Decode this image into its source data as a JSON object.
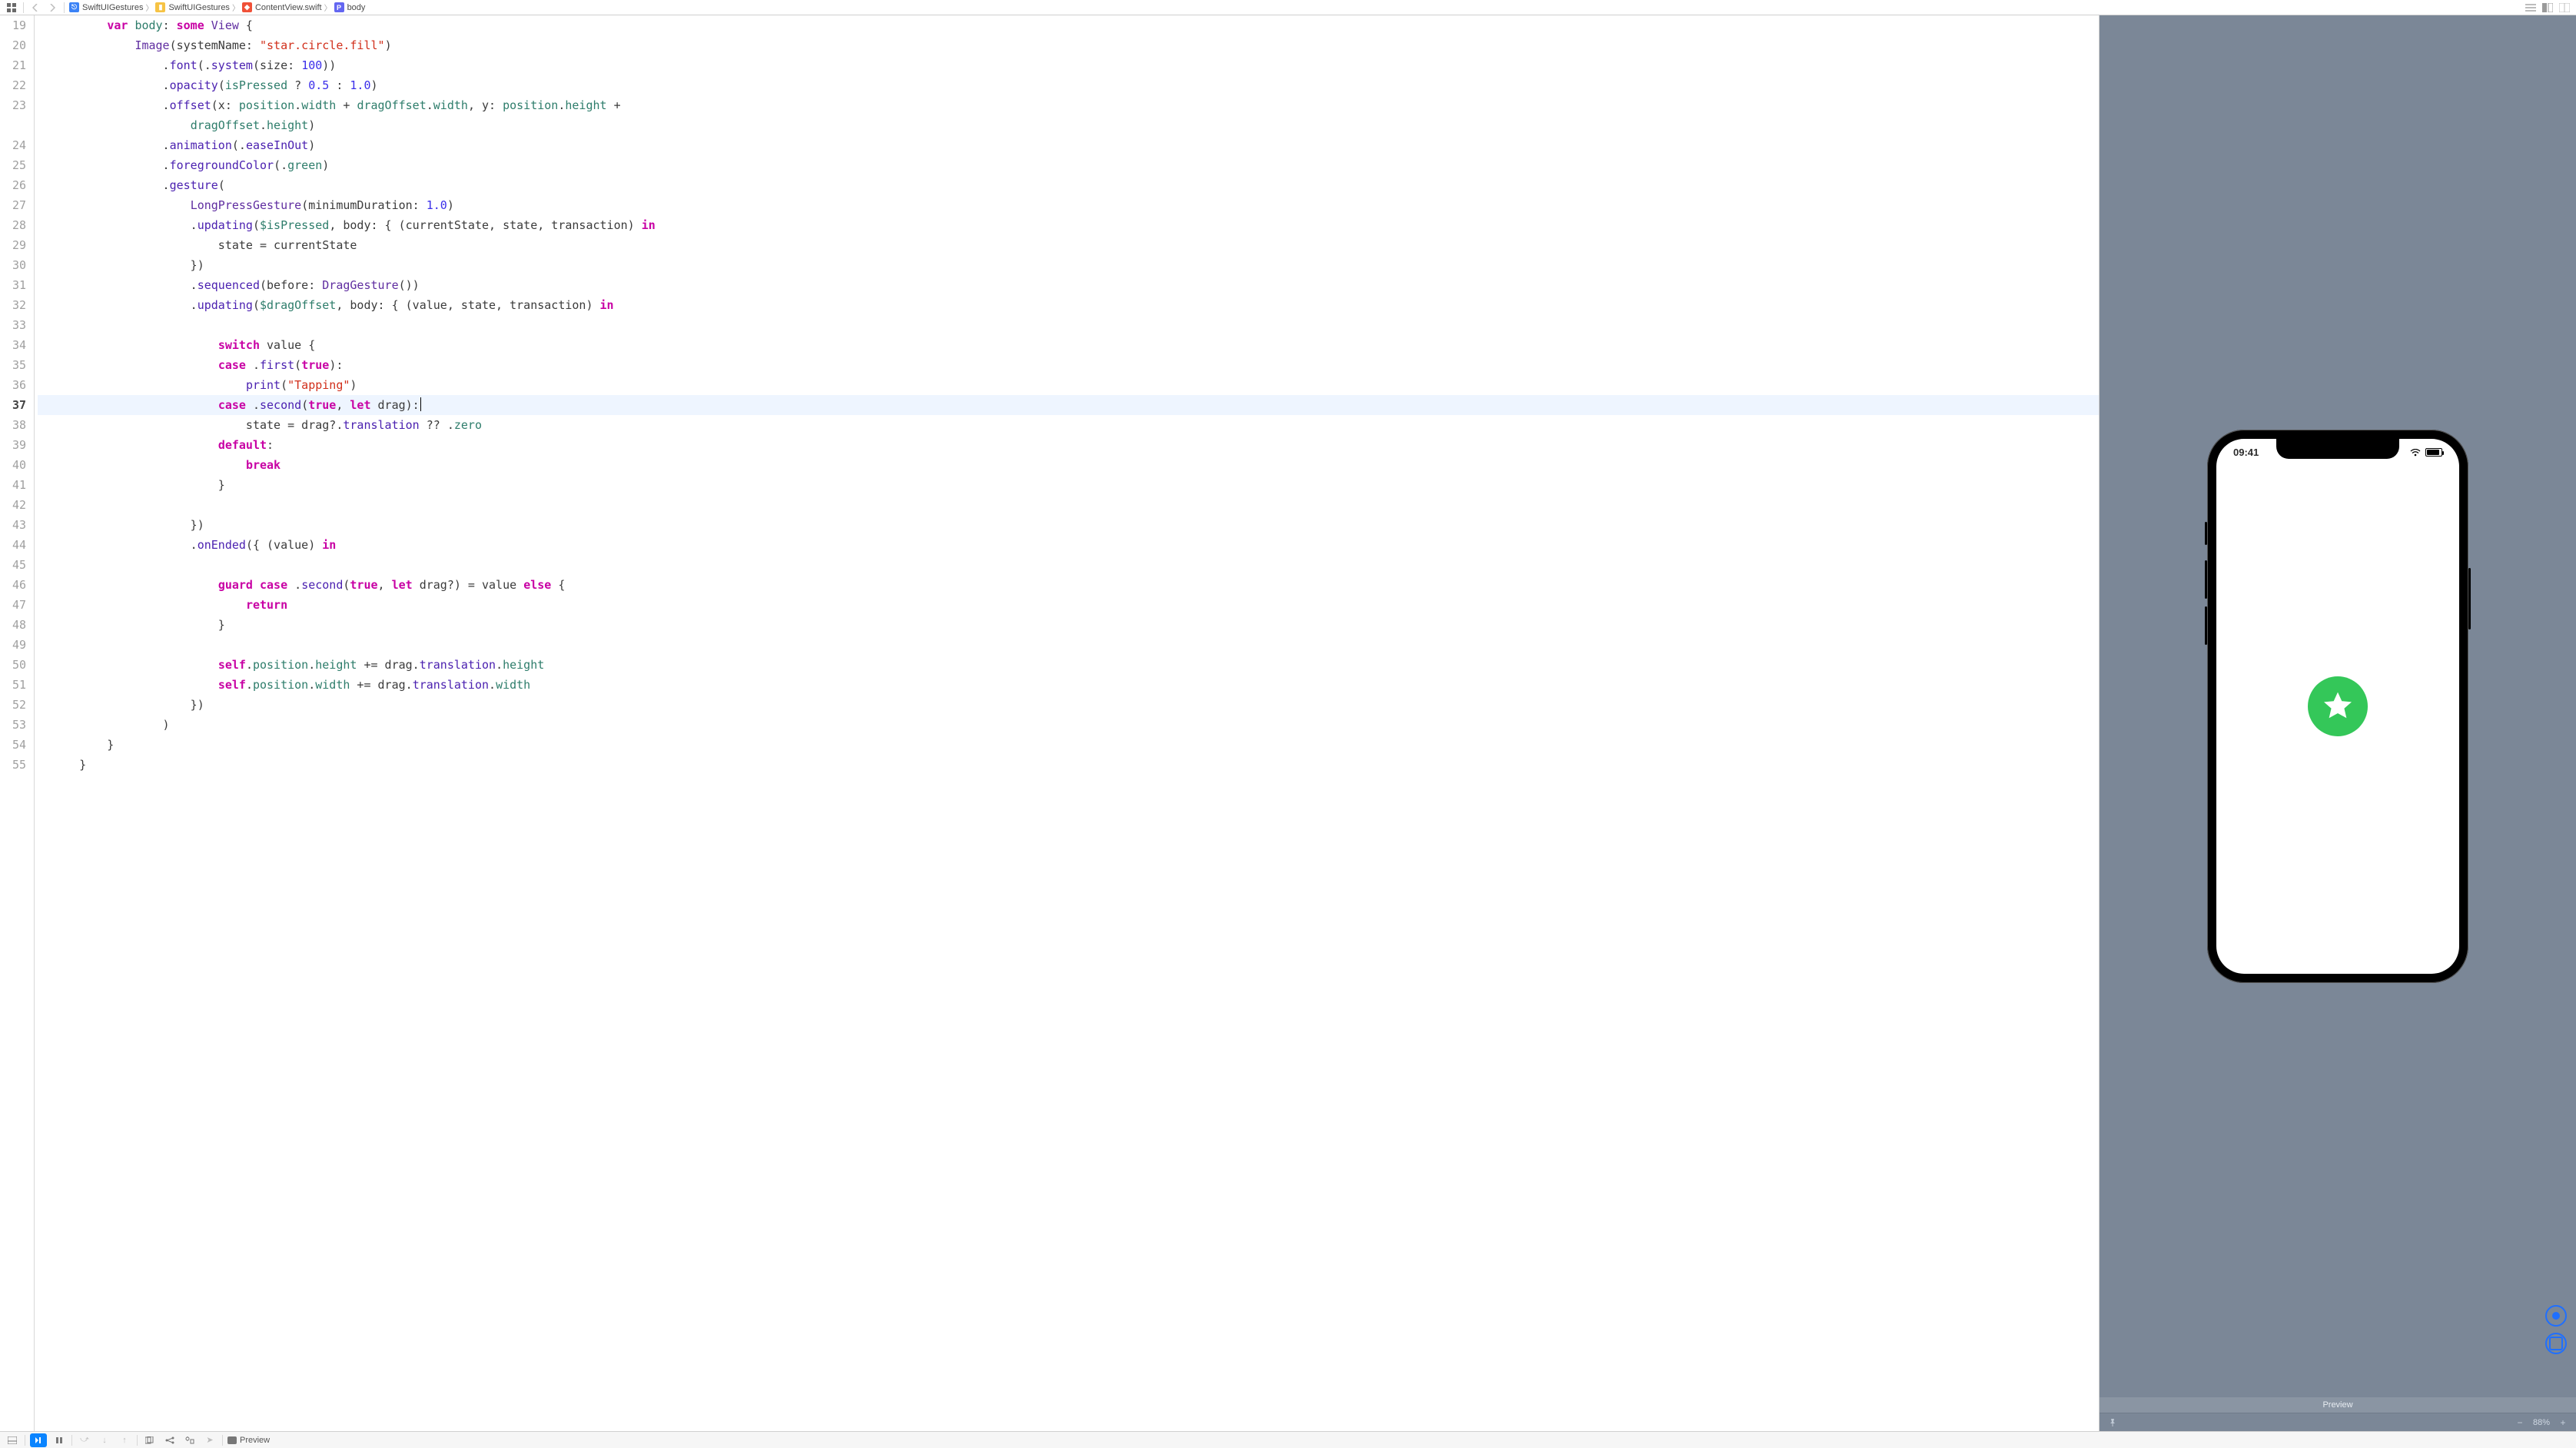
{
  "breadcrumb": {
    "items": [
      {
        "icon": "proj",
        "label": "SwiftUIGestures"
      },
      {
        "icon": "folder",
        "label": "SwiftUIGestures"
      },
      {
        "icon": "swift",
        "label": "ContentView.swift"
      },
      {
        "icon": "prop",
        "label": "body"
      }
    ]
  },
  "editor": {
    "first_line_number": 19,
    "highlighted_line": 37
  },
  "code_lines": [
    {
      "n": 19,
      "tokens": [
        [
          "pl",
          "          "
        ],
        [
          "k",
          "var"
        ],
        [
          "pl",
          " "
        ],
        [
          "id",
          "body"
        ],
        [
          "pl",
          ": "
        ],
        [
          "k",
          "some"
        ],
        [
          "pl",
          " "
        ],
        [
          "ty",
          "View"
        ],
        [
          "pl",
          " {"
        ]
      ]
    },
    {
      "n": 20,
      "tokens": [
        [
          "pl",
          "              "
        ],
        [
          "ty",
          "Image"
        ],
        [
          "pl",
          "(systemName: "
        ],
        [
          "str",
          "\"star.circle.fill\""
        ],
        [
          "pl",
          ")"
        ]
      ]
    },
    {
      "n": 21,
      "tokens": [
        [
          "pl",
          "                  ."
        ],
        [
          "fn",
          "font"
        ],
        [
          "pl",
          "(."
        ],
        [
          "fn",
          "system"
        ],
        [
          "pl",
          "(size: "
        ],
        [
          "lit",
          "100"
        ],
        [
          "pl",
          "))"
        ]
      ]
    },
    {
      "n": 22,
      "tokens": [
        [
          "pl",
          "                  ."
        ],
        [
          "fn",
          "opacity"
        ],
        [
          "pl",
          "("
        ],
        [
          "id",
          "isPressed"
        ],
        [
          "pl",
          " ? "
        ],
        [
          "lit",
          "0.5"
        ],
        [
          "pl",
          " : "
        ],
        [
          "lit",
          "1.0"
        ],
        [
          "pl",
          ")"
        ]
      ]
    },
    {
      "n": 23,
      "tokens": [
        [
          "pl",
          "                  ."
        ],
        [
          "fn",
          "offset"
        ],
        [
          "pl",
          "(x: "
        ],
        [
          "id",
          "position"
        ],
        [
          "pl",
          "."
        ],
        [
          "id",
          "width"
        ],
        [
          "pl",
          " + "
        ],
        [
          "id",
          "dragOffset"
        ],
        [
          "pl",
          "."
        ],
        [
          "id",
          "width"
        ],
        [
          "pl",
          ", y: "
        ],
        [
          "id",
          "position"
        ],
        [
          "pl",
          "."
        ],
        [
          "id",
          "height"
        ],
        [
          "pl",
          " +"
        ]
      ]
    },
    {
      "n": 20.5,
      "cont": true,
      "tokens": [
        [
          "pl",
          "                      "
        ],
        [
          "id",
          "dragOffset"
        ],
        [
          "pl",
          "."
        ],
        [
          "id",
          "height"
        ],
        [
          "pl",
          ")"
        ]
      ]
    },
    {
      "n": 24,
      "tokens": [
        [
          "pl",
          "                  ."
        ],
        [
          "fn",
          "animation"
        ],
        [
          "pl",
          "(."
        ],
        [
          "fn",
          "easeInOut"
        ],
        [
          "pl",
          ")"
        ]
      ]
    },
    {
      "n": 25,
      "tokens": [
        [
          "pl",
          "                  ."
        ],
        [
          "fn",
          "foregroundColor"
        ],
        [
          "pl",
          "(."
        ],
        [
          "id",
          "green"
        ],
        [
          "pl",
          ")"
        ]
      ]
    },
    {
      "n": 26,
      "tokens": [
        [
          "pl",
          "                  ."
        ],
        [
          "fn",
          "gesture"
        ],
        [
          "pl",
          "("
        ]
      ]
    },
    {
      "n": 27,
      "tokens": [
        [
          "pl",
          "                      "
        ],
        [
          "ty",
          "LongPressGesture"
        ],
        [
          "pl",
          "(minimumDuration: "
        ],
        [
          "lit",
          "1.0"
        ],
        [
          "pl",
          ")"
        ]
      ]
    },
    {
      "n": 28,
      "tokens": [
        [
          "pl",
          "                      ."
        ],
        [
          "fn",
          "updating"
        ],
        [
          "pl",
          "("
        ],
        [
          "id",
          "$isPressed"
        ],
        [
          "pl",
          ", body: { (currentState, state, transaction) "
        ],
        [
          "k",
          "in"
        ]
      ]
    },
    {
      "n": 29,
      "tokens": [
        [
          "pl",
          "                          state = currentState"
        ]
      ]
    },
    {
      "n": 30,
      "tokens": [
        [
          "pl",
          "                      })"
        ]
      ]
    },
    {
      "n": 31,
      "tokens": [
        [
          "pl",
          "                      ."
        ],
        [
          "fn",
          "sequenced"
        ],
        [
          "pl",
          "(before: "
        ],
        [
          "ty",
          "DragGesture"
        ],
        [
          "pl",
          "())"
        ]
      ]
    },
    {
      "n": 32,
      "tokens": [
        [
          "pl",
          "                      ."
        ],
        [
          "fn",
          "updating"
        ],
        [
          "pl",
          "("
        ],
        [
          "id",
          "$dragOffset"
        ],
        [
          "pl",
          ", body: { (value, state, transaction) "
        ],
        [
          "k",
          "in"
        ]
      ]
    },
    {
      "n": 33,
      "tokens": [
        [
          "pl",
          "                          "
        ]
      ]
    },
    {
      "n": 34,
      "tokens": [
        [
          "pl",
          "                          "
        ],
        [
          "k",
          "switch"
        ],
        [
          "pl",
          " value {"
        ]
      ]
    },
    {
      "n": 35,
      "tokens": [
        [
          "pl",
          "                          "
        ],
        [
          "k",
          "case"
        ],
        [
          "pl",
          " ."
        ],
        [
          "fn",
          "first"
        ],
        [
          "pl",
          "("
        ],
        [
          "k",
          "true"
        ],
        [
          "pl",
          "):"
        ]
      ]
    },
    {
      "n": 36,
      "tokens": [
        [
          "pl",
          "                              "
        ],
        [
          "fn",
          "print"
        ],
        [
          "pl",
          "("
        ],
        [
          "str",
          "\"Tapping\""
        ],
        [
          "pl",
          ")"
        ]
      ]
    },
    {
      "n": 37,
      "hl": true,
      "tokens": [
        [
          "pl",
          "                          "
        ],
        [
          "k",
          "case"
        ],
        [
          "pl",
          " ."
        ],
        [
          "fn",
          "second"
        ],
        [
          "pl",
          "("
        ],
        [
          "k",
          "true"
        ],
        [
          "pl",
          ", "
        ],
        [
          "k",
          "let"
        ],
        [
          "pl",
          " drag):"
        ],
        [
          "cursor",
          ""
        ]
      ]
    },
    {
      "n": 38,
      "tokens": [
        [
          "pl",
          "                              state = drag?."
        ],
        [
          "fn",
          "translation"
        ],
        [
          "pl",
          " ?? ."
        ],
        [
          "id",
          "zero"
        ]
      ]
    },
    {
      "n": 39,
      "tokens": [
        [
          "pl",
          "                          "
        ],
        [
          "k",
          "default"
        ],
        [
          "pl",
          ":"
        ]
      ]
    },
    {
      "n": 40,
      "tokens": [
        [
          "pl",
          "                              "
        ],
        [
          "k",
          "break"
        ]
      ]
    },
    {
      "n": 41,
      "tokens": [
        [
          "pl",
          "                          }"
        ]
      ]
    },
    {
      "n": 42,
      "tokens": [
        [
          "pl",
          "                          "
        ]
      ]
    },
    {
      "n": 43,
      "tokens": [
        [
          "pl",
          "                      })"
        ]
      ]
    },
    {
      "n": 44,
      "tokens": [
        [
          "pl",
          "                      ."
        ],
        [
          "fn",
          "onEnded"
        ],
        [
          "pl",
          "({ (value) "
        ],
        [
          "k",
          "in"
        ]
      ]
    },
    {
      "n": 45,
      "tokens": [
        [
          "pl",
          "                          "
        ]
      ]
    },
    {
      "n": 46,
      "tokens": [
        [
          "pl",
          "                          "
        ],
        [
          "k",
          "guard"
        ],
        [
          "pl",
          " "
        ],
        [
          "k",
          "case"
        ],
        [
          "pl",
          " ."
        ],
        [
          "fn",
          "second"
        ],
        [
          "pl",
          "("
        ],
        [
          "k",
          "true"
        ],
        [
          "pl",
          ", "
        ],
        [
          "k",
          "let"
        ],
        [
          "pl",
          " drag?) = value "
        ],
        [
          "k",
          "else"
        ],
        [
          "pl",
          " {"
        ]
      ]
    },
    {
      "n": 47,
      "tokens": [
        [
          "pl",
          "                              "
        ],
        [
          "k",
          "return"
        ]
      ]
    },
    {
      "n": 48,
      "tokens": [
        [
          "pl",
          "                          }"
        ]
      ]
    },
    {
      "n": 49,
      "tokens": [
        [
          "pl",
          "                          "
        ]
      ]
    },
    {
      "n": 50,
      "tokens": [
        [
          "pl",
          "                          "
        ],
        [
          "k",
          "self"
        ],
        [
          "pl",
          "."
        ],
        [
          "id",
          "position"
        ],
        [
          "pl",
          "."
        ],
        [
          "id",
          "height"
        ],
        [
          "pl",
          " += drag."
        ],
        [
          "fn",
          "translation"
        ],
        [
          "pl",
          "."
        ],
        [
          "id",
          "height"
        ]
      ]
    },
    {
      "n": 51,
      "tokens": [
        [
          "pl",
          "                          "
        ],
        [
          "k",
          "self"
        ],
        [
          "pl",
          "."
        ],
        [
          "id",
          "position"
        ],
        [
          "pl",
          "."
        ],
        [
          "id",
          "width"
        ],
        [
          "pl",
          " += drag."
        ],
        [
          "fn",
          "translation"
        ],
        [
          "pl",
          "."
        ],
        [
          "id",
          "width"
        ]
      ]
    },
    {
      "n": 52,
      "tokens": [
        [
          "pl",
          "                      })"
        ]
      ]
    },
    {
      "n": 53,
      "tokens": [
        [
          "pl",
          "                  )"
        ]
      ]
    },
    {
      "n": 54,
      "tokens": [
        [
          "pl",
          "          }"
        ]
      ]
    },
    {
      "n": 55,
      "tokens": [
        [
          "pl",
          "      }"
        ]
      ]
    }
  ],
  "preview": {
    "device_time": "09:41",
    "label": "Preview",
    "zoom": "88%",
    "star_color": "#34c759"
  },
  "bottombar": {
    "preview_label": "Preview"
  }
}
